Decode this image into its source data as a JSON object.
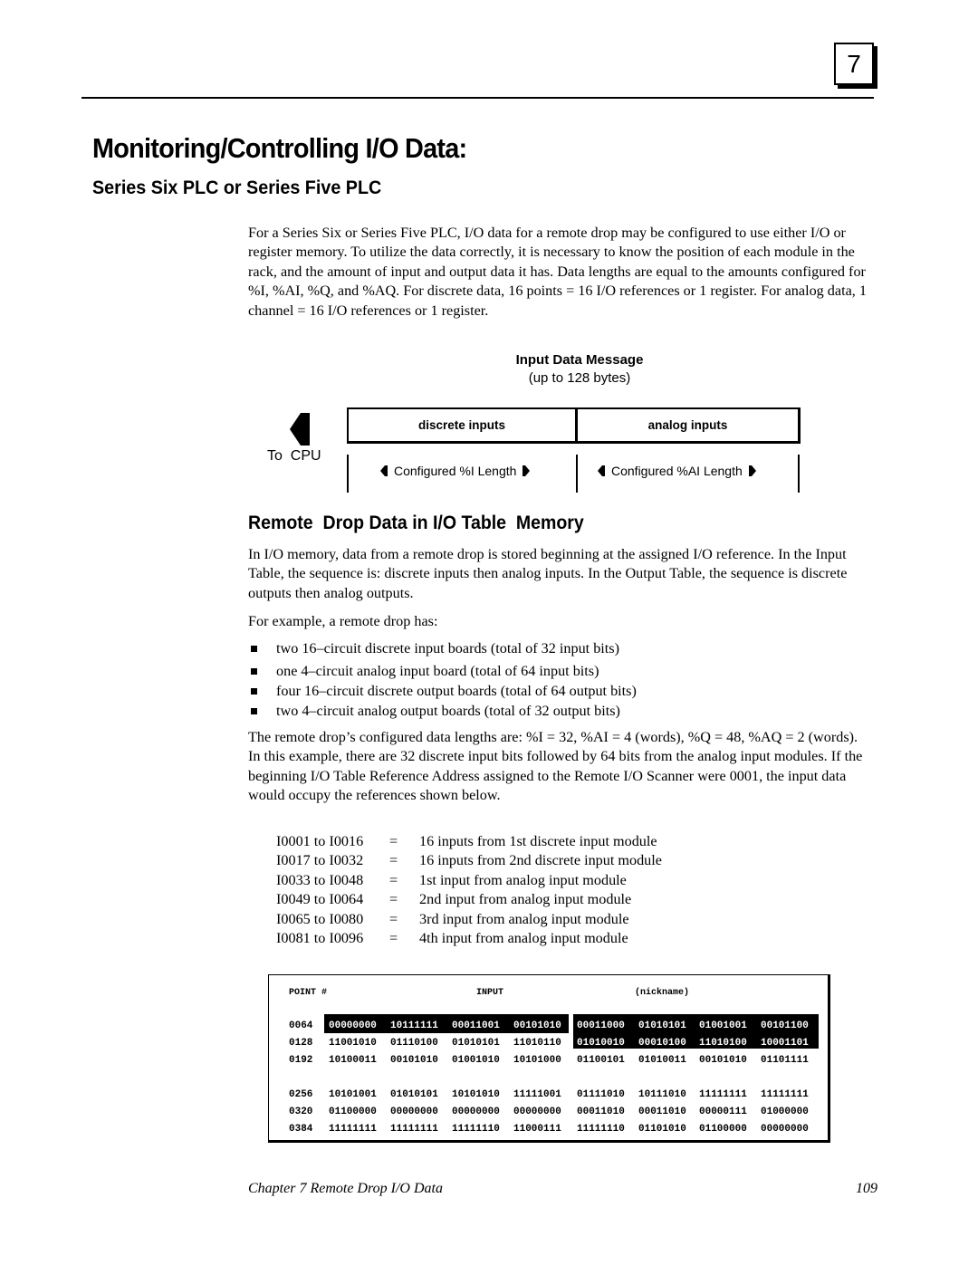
{
  "chapter_number": "7",
  "title": "Monitoring/Controlling I/O Data:",
  "subtitle": "Series Six PLC or Series Five PLC",
  "intro_paragraph": "For a Series Six or Series Five PLC, I/O data for a remote drop may be configured to use either I/O or register memory.  To utilize the data correctly, it is necessary to know the position of each module in the rack, and the amount of input and output data it has. Data lengths are equal to the amounts configured for %I, %AI, %Q, and %AQ. For discrete data, 16 points = 16 I/O references or 1 register.  For analog data, 1 channel = 16 I/O references or 1 register.",
  "diagram": {
    "title": "Input Data Message",
    "subtitle": "(up to 128 bytes)",
    "direction_label": "To  CPU",
    "fields": [
      {
        "label": "discrete inputs",
        "length_label": "Configured %I Length"
      },
      {
        "label": "analog inputs",
        "length_label": "Configured %AI Length"
      }
    ]
  },
  "section_heading": "Remote  Drop Data in I/O Table  Memory",
  "section_paragraph": "In I/O memory, data from a remote drop is stored beginning at the assigned I/O reference.  In the Input Table, the sequence is: discrete inputs then analog inputs.  In the Output Table, the sequence is discrete outputs then analog outputs.",
  "example_intro": "For example, a remote drop has:",
  "example_items": [
    "two 16–circuit discrete input boards (total of 32 input bits)",
    "one 4–circuit analog input board (total of 64 input bits)",
    "four 16–circuit discrete output boards (total of 64 output bits)",
    "two 4–circuit analog output boards (total of 32 output bits)"
  ],
  "lengths_paragraph": "The remote drop’s configured data lengths are: %I = 32, %AI = 4 (words), %Q = 48, %AQ = 2 (words).  In this example, there are 32 discrete input bits followed by 64 bits from the analog input modules.  If the beginning I/O Table Reference Address assigned to the Remote I/O Scanner were 0001, the input data would occupy the references shown below.",
  "reference_map": [
    {
      "range": "I0001 to I0016",
      "eq": "=",
      "desc": "16 inputs from 1st discrete input module"
    },
    {
      "range": "I0017 to I0032",
      "eq": "=",
      "desc": "16 inputs from 2nd discrete input module"
    },
    {
      "range": "I0033 to I0048",
      "eq": "=",
      "desc": "1st input from analog input module"
    },
    {
      "range": "I0049 to I0064",
      "eq": "=",
      "desc": "2nd input from analog input module"
    },
    {
      "range": "I0065 to I0080",
      "eq": "=",
      "desc": "3rd input from analog input module"
    },
    {
      "range": "I0081 to I0096",
      "eq": "=",
      "desc": "4th input from analog input module"
    }
  ],
  "io_table": {
    "headers": {
      "point": "POINT #",
      "input": "INPUT",
      "nickname": "(nickname)"
    },
    "rows": [
      {
        "point": "0064",
        "groups": [
          "00000000",
          "10111111",
          "00011001",
          "00101010",
          "00011000",
          "01010101",
          "01001001",
          "00101100"
        ]
      },
      {
        "point": "0128",
        "groups": [
          "11001010",
          "01110100",
          "01010101",
          "11010110",
          "01010010",
          "00010100",
          "11010100",
          "10001101"
        ]
      },
      {
        "point": "0192",
        "groups": [
          "10100011",
          "00101010",
          "01001010",
          "10101000",
          "01100101",
          "01010011",
          "00101010",
          "01101111"
        ]
      },
      {
        "point": "0256",
        "groups": [
          "10101001",
          "01010101",
          "10101010",
          "11111001",
          "01111010",
          "10111010",
          "11111111",
          "11111111"
        ]
      },
      {
        "point": "0320",
        "groups": [
          "01100000",
          "00000000",
          "00000000",
          "00000000",
          "00011010",
          "00011010",
          "00000111",
          "01000000"
        ]
      },
      {
        "point": "0384",
        "groups": [
          "11111111",
          "11111111",
          "11111110",
          "11000111",
          "11111110",
          "01101010",
          "01100000",
          "00000000"
        ]
      }
    ]
  },
  "footer": {
    "chapter": "Chapter 7 Remote Drop I/O Data",
    "page": "109"
  }
}
